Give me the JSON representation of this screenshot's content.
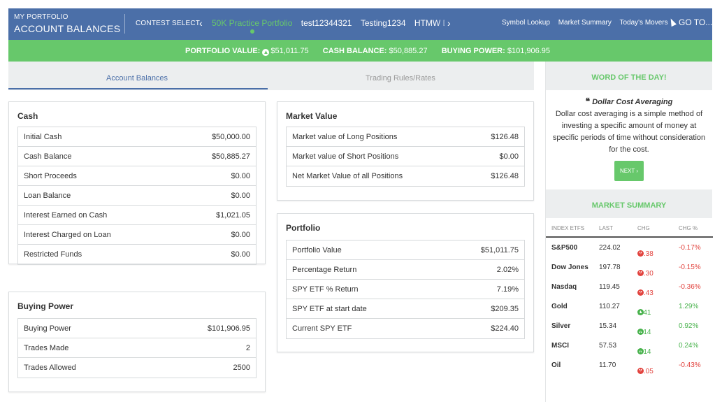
{
  "header": {
    "portfolio_label": "MY PORTFOLIO",
    "page_title": "ACCOUNT BALANCES",
    "contest_select_label": "CONTEST SELECT",
    "contests": [
      {
        "label": "50K Practice Portfolio",
        "active": true
      },
      {
        "label": "test12344321",
        "active": false
      },
      {
        "label": "Testing1234",
        "active": false
      },
      {
        "label": "HTMW De",
        "active": false
      }
    ],
    "links": [
      "Symbol Lookup",
      "Market Summary",
      "Today's Movers"
    ],
    "goto_label": "GO TO..."
  },
  "summary_bar": {
    "portfolio_value_label": "PORTFOLIO VALUE:",
    "portfolio_value": "$51,011.75",
    "cash_balance_label": "CASH BALANCE:",
    "cash_balance": "$50,885.27",
    "buying_power_label": "BUYING POWER:",
    "buying_power": "$101,906.95"
  },
  "tabs": {
    "account_balances": "Account Balances",
    "trading_rules": "Trading Rules/Rates"
  },
  "cash": {
    "title": "Cash",
    "rows": [
      {
        "label": "Initial Cash",
        "value": "$50,000.00"
      },
      {
        "label": "Cash Balance",
        "value": "$50,885.27"
      },
      {
        "label": "Short Proceeds",
        "value": "$0.00"
      },
      {
        "label": "Loan Balance",
        "value": "$0.00"
      },
      {
        "label": "Interest Earned on Cash",
        "value": "$1,021.05"
      },
      {
        "label": "Interest Charged on Loan",
        "value": "$0.00"
      },
      {
        "label": "Restricted Funds",
        "value": "$0.00"
      }
    ]
  },
  "buying_power": {
    "title": "Buying Power",
    "rows": [
      {
        "label": "Buying Power",
        "value": "$101,906.95"
      },
      {
        "label": "Trades Made",
        "value": "2"
      },
      {
        "label": "Trades Allowed",
        "value": "2500"
      }
    ]
  },
  "market_value": {
    "title": "Market Value",
    "rows": [
      {
        "label": "Market value of Long Positions",
        "value": "$126.48"
      },
      {
        "label": "Market value of Short Positions",
        "value": "$0.00"
      },
      {
        "label": "Net Market Value of all Positions",
        "value": "$126.48"
      }
    ]
  },
  "portfolio": {
    "title": "Portfolio",
    "rows": [
      {
        "label": "Portfolio Value",
        "value": "$51,011.75"
      },
      {
        "label": "Percentage Return",
        "value": "2.02%"
      },
      {
        "label": "SPY ETF % Return",
        "value": "7.19%"
      },
      {
        "label": "SPY ETF at start date",
        "value": "$209.35"
      },
      {
        "label": "Current SPY ETF",
        "value": "$224.40"
      }
    ]
  },
  "word_of_day": {
    "title": "WORD OF THE DAY!",
    "term": "Dollar Cost Averaging",
    "definition": "Dollar cost averaging is a simple method of investing a specific amount of money at specific periods of time without consideration for the cost.",
    "next_label": "NEXT"
  },
  "market_summary": {
    "title": "MARKET SUMMARY",
    "columns": [
      "INDEX ETFS",
      "LAST",
      "CHG",
      "CHG %"
    ],
    "rows": [
      {
        "name": "S&P500",
        "last": "224.02",
        "chg": "-0.38",
        "chg_pct": "-0.17%",
        "dir": "down"
      },
      {
        "name": "Dow Jones",
        "last": "197.78",
        "chg": "-0.30",
        "chg_pct": "-0.15%",
        "dir": "down"
      },
      {
        "name": "Nasdaq",
        "last": "119.45",
        "chg": "-0.43",
        "chg_pct": "-0.36%",
        "dir": "down"
      },
      {
        "name": "Gold",
        "last": "110.27",
        "chg": "1.41",
        "chg_pct": "1.29%",
        "dir": "up"
      },
      {
        "name": "Silver",
        "last": "15.34",
        "chg": "0.14",
        "chg_pct": "0.92%",
        "dir": "up"
      },
      {
        "name": "MSCI",
        "last": "57.53",
        "chg": "0.14",
        "chg_pct": "0.24%",
        "dir": "up"
      },
      {
        "name": "Oil",
        "last": "11.70",
        "chg": "-0.05",
        "chg_pct": "-0.43%",
        "dir": "down"
      }
    ]
  },
  "colors": {
    "header_blue": "#4b6fa8",
    "accent_green": "#67c86b",
    "negative_red": "#e2443f",
    "positive_green": "#48b24c"
  }
}
